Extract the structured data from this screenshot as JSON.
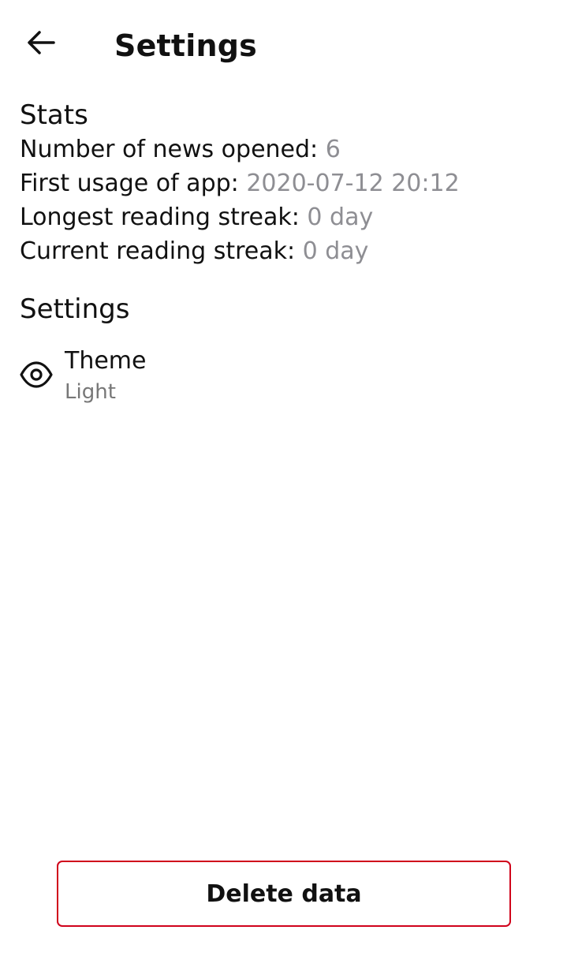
{
  "header": {
    "back_icon": "arrow-left-icon",
    "title": "Settings"
  },
  "stats": {
    "heading": "Stats",
    "rows": [
      {
        "label": "Number of news opened: ",
        "value": "6"
      },
      {
        "label": "First usage of app: ",
        "value": "2020-07-12 20:12"
      },
      {
        "label": "Longest reading streak: ",
        "value": "0 day"
      },
      {
        "label": "Current reading streak: ",
        "value": "0 day"
      }
    ]
  },
  "settings": {
    "heading": "Settings",
    "items": [
      {
        "icon": "eye-icon",
        "label": "Theme",
        "value": "Light"
      }
    ]
  },
  "actions": {
    "delete_label": "Delete data"
  },
  "colors": {
    "text_primary": "#111111",
    "text_secondary": "#8e8e93",
    "danger_border": "#d0021b",
    "background": "#ffffff"
  }
}
